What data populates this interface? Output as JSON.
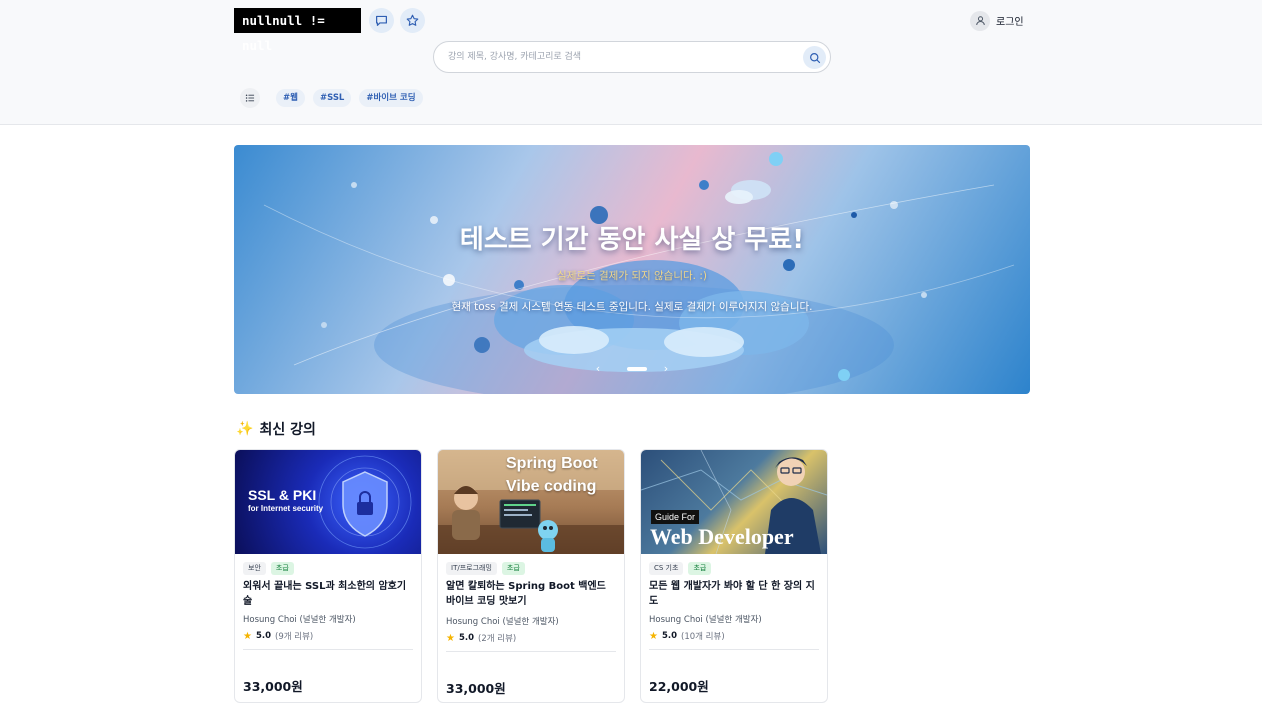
{
  "header": {
    "logo": "nullnull != null",
    "login_label": "로그인",
    "search_placeholder": "강의 제목, 강사명, 카테고리로 검색",
    "tags": [
      "#웹",
      "#SSL",
      "#바이브 코딩"
    ]
  },
  "banner": {
    "title": "테스트 기간 동안 사실 상 무료!",
    "subtitle": "실제로는 결제가 되지 않습니다. :)",
    "description": "현재 toss 결제 시스템 연동 테스트 중입니다. 실제로 결제가 이루어지지 않습니다."
  },
  "section": {
    "icon": "sparkles-icon",
    "title": "최신 강의"
  },
  "courses": [
    {
      "thumb_title": "SSL & PKI",
      "thumb_sub": "for Internet security",
      "category": "보안",
      "level": "초급",
      "title": "외워서 끝내는 SSL과 최소한의 암호기술",
      "author": "Hosung Choi (널널한 개발자)",
      "rating": "5.0",
      "reviews": "(9개 리뷰)",
      "price": "33,000원"
    },
    {
      "thumb_title": "Spring Boot",
      "thumb_sub": "Vibe coding",
      "category": "IT/프로그래밍",
      "level": "초급",
      "title": "알면 칼퇴하는 Spring Boot 백엔드 바이브 코딩 맛보기",
      "author": "Hosung Choi (널널한 개발자)",
      "rating": "5.0",
      "reviews": "(2개 리뷰)",
      "price": "33,000원"
    },
    {
      "thumb_title": "Web Developer",
      "thumb_sub": "Guide For",
      "category": "CS 기초",
      "level": "초급",
      "title": "모든 웹 개발자가 봐야 할 단 한 장의 지도",
      "author": "Hosung Choi (널널한 개발자)",
      "rating": "5.0",
      "reviews": "(10개 리뷰)",
      "price": "22,000원"
    }
  ],
  "colors": {
    "accent": "#2f5fb3",
    "level_green": "#15803d",
    "star": "#f5b400"
  }
}
